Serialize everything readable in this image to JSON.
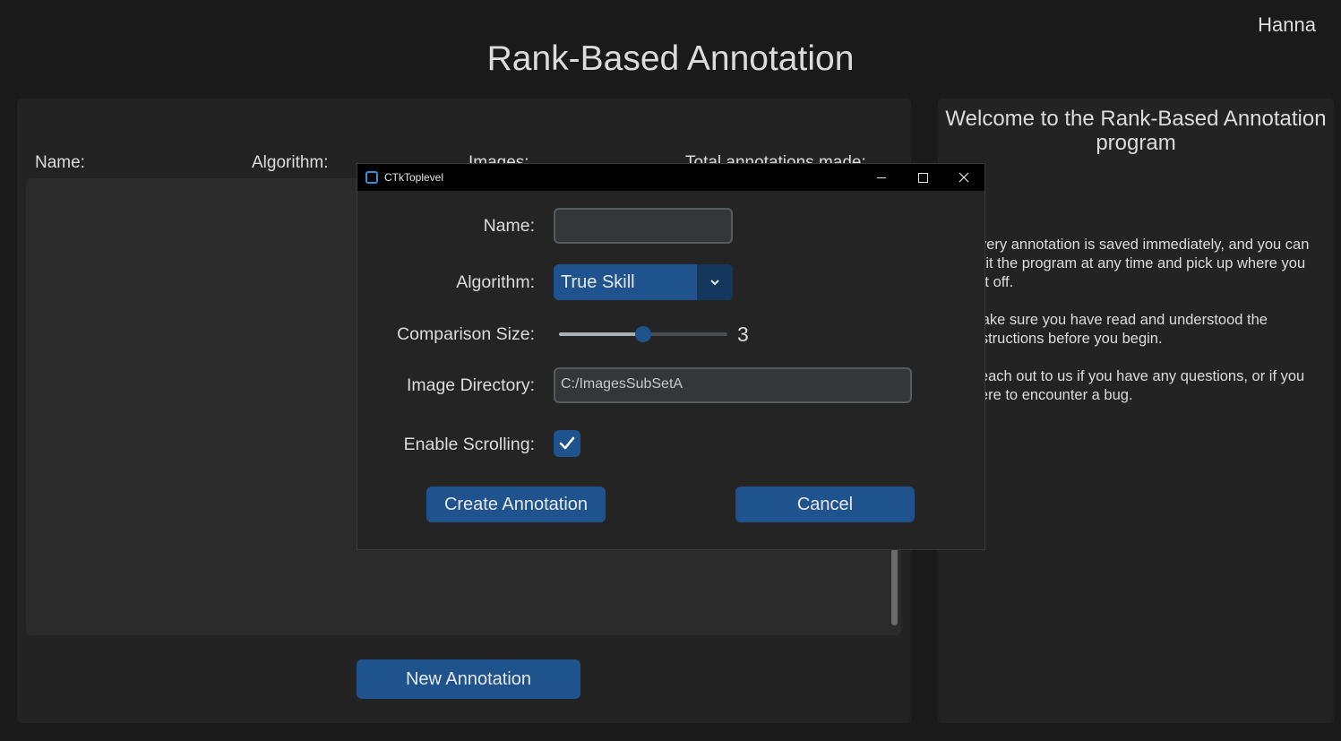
{
  "header": {
    "user": "Hanna",
    "title": "Rank-Based Annotation"
  },
  "left_panel": {
    "columns": [
      "Name:",
      "Algorithm:",
      "Images:",
      "Total annotations made:"
    ],
    "new_button": "New Annotation"
  },
  "right_panel": {
    "welcome_title": "Welcome to the Rank-Based Annotation program",
    "paragraphs": [
      "Every annotation is saved immediately, and you can quit the program at any time and pick up where you left off.",
      "Make sure you have read and understood the instructions before you begin.",
      "Reach out to us if you have any questions, or if you were to encounter a bug."
    ]
  },
  "dialog": {
    "window_title": "CTkToplevel",
    "labels": {
      "name": "Name:",
      "algorithm": "Algorithm:",
      "comparison_size": "Comparison Size:",
      "image_directory": "Image Directory:",
      "enable_scrolling": "Enable Scrolling:"
    },
    "name_value": "",
    "algorithm_value": "True Skill",
    "comparison_size": {
      "value": "3",
      "fraction": 0.5
    },
    "image_directory_value": "C:/ImagesSubSetA",
    "enable_scrolling_checked": true,
    "create_button": "Create Annotation",
    "cancel_button": "Cancel"
  },
  "colors": {
    "accent": "#1f538d",
    "background": "#1a1a1a",
    "panel": "#232323"
  }
}
